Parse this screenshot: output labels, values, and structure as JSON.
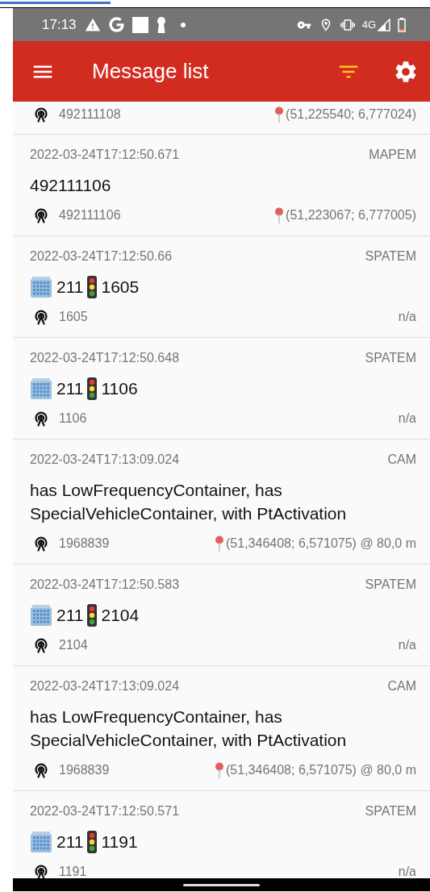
{
  "status_bar": {
    "time": "17:13",
    "network": "4G"
  },
  "app_bar": {
    "title": "Message list",
    "filter_active": true
  },
  "messages": [
    {
      "station": "492111108",
      "location": "(51,225540; 6,777024)",
      "pinned": true
    },
    {
      "timestamp": "2022-03-24T17:12:50.671",
      "type": "MAPEM",
      "title": {
        "kind": "text",
        "text": "492111106"
      },
      "station": "492111106",
      "location": "(51,223067; 6,777005)",
      "pinned": true
    },
    {
      "timestamp": "2022-03-24T17:12:50.66",
      "type": "SPATEM",
      "title": {
        "kind": "spat",
        "intersection": "211",
        "signal_group": "1605"
      },
      "station": "1605",
      "location": "n/a",
      "pinned": false
    },
    {
      "timestamp": "2022-03-24T17:12:50.648",
      "type": "SPATEM",
      "title": {
        "kind": "spat",
        "intersection": "211",
        "signal_group": "1106"
      },
      "station": "1106",
      "location": "n/a",
      "pinned": false
    },
    {
      "timestamp": "2022-03-24T17:13:09.024",
      "type": "CAM",
      "title": {
        "kind": "text",
        "text": "has LowFrequencyContainer, has SpecialVehicleContainer, with PtActivation"
      },
      "station": "1968839",
      "location": "(51,346408; 6,571075) @ 80,0 m",
      "pinned": true
    },
    {
      "timestamp": "2022-03-24T17:12:50.583",
      "type": "SPATEM",
      "title": {
        "kind": "spat",
        "intersection": "211",
        "signal_group": "2104"
      },
      "station": "2104",
      "location": "n/a",
      "pinned": false
    },
    {
      "timestamp": "2022-03-24T17:13:09.024",
      "type": "CAM",
      "title": {
        "kind": "text",
        "text": "has LowFrequencyContainer, has SpecialVehicleContainer, with PtActivation"
      },
      "station": "1968839",
      "location": "(51,346408; 6,571075) @ 80,0 m",
      "pinned": true
    },
    {
      "timestamp": "2022-03-24T17:12:50.571",
      "type": "SPATEM",
      "title": {
        "kind": "spat",
        "intersection": "211",
        "signal_group": "1191"
      },
      "station": "1191",
      "location": "n/a",
      "pinned": false
    }
  ]
}
